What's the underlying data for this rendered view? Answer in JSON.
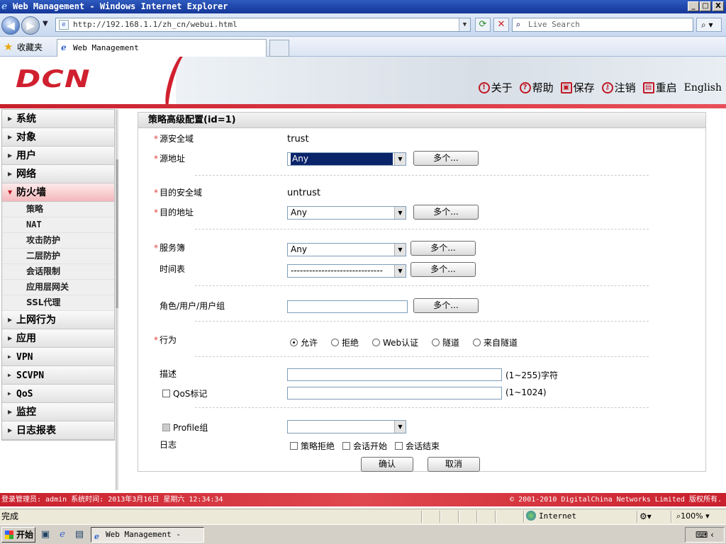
{
  "window": {
    "title": "Web Management - Windows Internet Explorer",
    "min_label": "_",
    "max_label": "□",
    "close_label": "X"
  },
  "addressbar": {
    "url": "http://192.168.1.1/zh_cn/webui.html",
    "search_placeholder": "Live Search"
  },
  "favorites": {
    "label": "收藏夹",
    "tab_title": "Web Management"
  },
  "banner": {
    "logo": "DCN",
    "menu": [
      {
        "label": "关于",
        "icon": "!"
      },
      {
        "label": "帮助",
        "icon": "?"
      },
      {
        "label": "保存",
        "icon": "▣"
      },
      {
        "label": "注销",
        "icon": "⚷"
      },
      {
        "label": "重启",
        "icon": "▤"
      },
      {
        "label": "English",
        "icon": ""
      }
    ]
  },
  "sidebar": {
    "items": [
      {
        "label": "系统"
      },
      {
        "label": "对象"
      },
      {
        "label": "用户"
      },
      {
        "label": "网络"
      },
      {
        "label": "防火墙",
        "active": true
      }
    ],
    "firewall_sub": [
      "策略",
      "NAT",
      "攻击防护",
      "二层防护",
      "会话限制",
      "应用层网关",
      "SSL代理"
    ],
    "items_after": [
      {
        "label": "上网行为"
      },
      {
        "label": "应用"
      },
      {
        "label": "VPN"
      },
      {
        "label": "SCVPN"
      },
      {
        "label": "QoS"
      },
      {
        "label": "监控"
      },
      {
        "label": "日志报表"
      }
    ]
  },
  "form": {
    "title": "策略高级配置(id=1)",
    "src_zone_label": "源安全域",
    "src_zone_value": "trust",
    "src_addr_label": "源地址",
    "src_addr_value": "Any",
    "dst_zone_label": "目的安全域",
    "dst_zone_value": "untrust",
    "dst_addr_label": "目的地址",
    "dst_addr_value": "Any",
    "service_label": "服务簿",
    "service_value": "Any",
    "schedule_label": "时间表",
    "schedule_value": "------------------------------",
    "role_label": "角色/用户/用户组",
    "multi_label": "多个...",
    "action_label": "行为",
    "actions": [
      "允许",
      "拒绝",
      "Web认证",
      "隧道",
      "来自隧道"
    ],
    "desc_label": "描述",
    "desc_hint": "(1~255)字符",
    "qos_label": "QoS标记",
    "qos_hint": "(1~1024)",
    "profile_label": "Profile组",
    "log_label": "日志",
    "log_options": [
      "策略拒绝",
      "会话开始",
      "会话结束"
    ],
    "ok_label": "确认",
    "cancel_label": "取消",
    "required_mark": "*"
  },
  "footer": {
    "left": "登录管理员: admin 系统时间: 2013年3月16日 星期六 12:34:34",
    "right": "© 2001-2010 DigitalChina Networks Limited 版权所有."
  },
  "statusbar": {
    "text": "完成",
    "zone": "Internet",
    "zoom": "100%"
  },
  "taskbar": {
    "start": "开始",
    "task": "Web Management - Wi..."
  },
  "colors": {
    "brand_red": "#d0202f",
    "ie_blue": "#1e44a8"
  }
}
